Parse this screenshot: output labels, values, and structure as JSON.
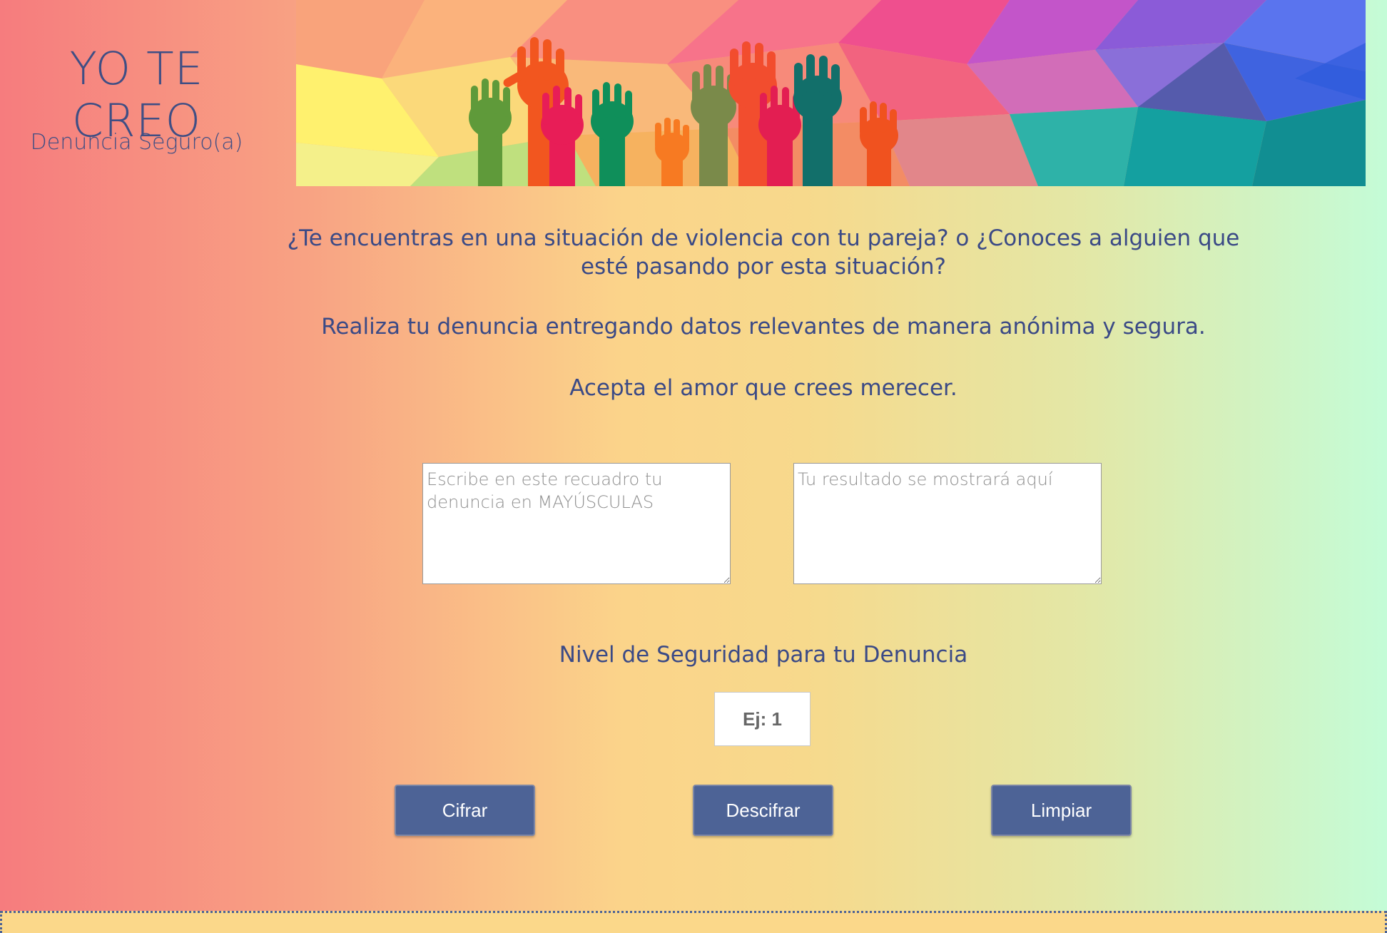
{
  "brand": {
    "title": "YO TE CREO",
    "subtitle": "Denuncia Seguro(a)"
  },
  "banner": {
    "icon": "raised-hands-banner"
  },
  "intro": {
    "question": "¿Te encuentras en una situación de violencia con tu pareja? o ¿Conoces a alguien que esté pasando por esta situación?",
    "report": "Realiza tu denuncia entregando datos relevantes de manera anónima y segura.",
    "accept": "Acepta el amor que crees merecer."
  },
  "form": {
    "input_placeholder": "Escribe en este recuadro tu denuncia en MAYÚSCULAS",
    "output_placeholder": "Tu resultado se mostrará aquí",
    "level_label": "Nivel de Seguridad para tu Denuncia",
    "level_placeholder": "Ej: 1"
  },
  "buttons": {
    "cipher": "Cifrar",
    "decipher": "Descifrar",
    "clear": "Limpiar"
  },
  "colors": {
    "text": "#3b4a86",
    "button": "#4d6396",
    "gradient_left": "#f67c7e",
    "gradient_mid": "#fbd48a",
    "gradient_right": "#c4fcd7"
  }
}
